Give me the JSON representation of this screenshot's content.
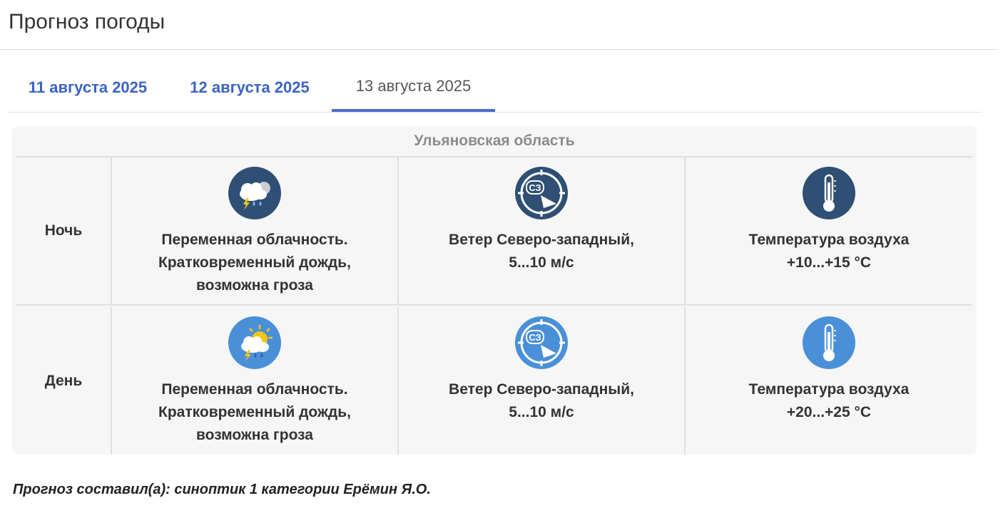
{
  "page": {
    "title": "Прогноз погоды"
  },
  "tabs": [
    {
      "label": "11 августа 2025",
      "active": false
    },
    {
      "label": "12 августа 2025",
      "active": false
    },
    {
      "label": "13 августа 2025",
      "active": true
    }
  ],
  "region": "Ульяновская область",
  "colors": {
    "night_icon": "#2f4f74",
    "day_icon": "#4a90d9",
    "link": "#3b63c4",
    "tab_underline": "#4a6fc9"
  },
  "periods": {
    "night": {
      "label": "Ночь",
      "icon_bg": "#2f4f74",
      "weather": [
        "Переменная облачность.",
        "Кратковременный дождь,",
        "возможна гроза"
      ],
      "wind_dir": "СЗ",
      "wind": [
        "Ветер Северо-западный,",
        "5...10 м/с"
      ],
      "temp": [
        "Температура воздуха",
        "+10...+15 °С"
      ]
    },
    "day": {
      "label": "День",
      "icon_bg": "#4a90d9",
      "weather": [
        "Переменная облачность.",
        "Кратковременный дождь,",
        "возможна гроза"
      ],
      "wind_dir": "СЗ",
      "wind": [
        "Ветер Северо-западный,",
        "5...10 м/с"
      ],
      "temp": [
        "Температура воздуха",
        "+20...+25 °С"
      ]
    }
  },
  "author": "Прогноз составил(а): синоптик 1 категории Ерёмин Я.О."
}
